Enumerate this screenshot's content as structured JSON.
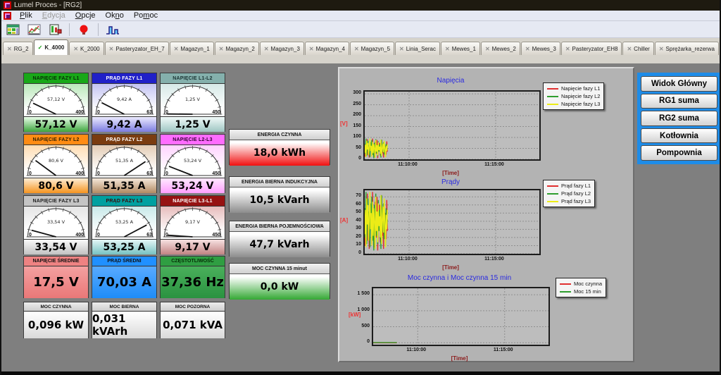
{
  "window": {
    "title": "Lumel Proces - [RG2]"
  },
  "menu": {
    "items": [
      {
        "label": "Plik",
        "accel": "P",
        "disabled": false
      },
      {
        "label": "Edycja",
        "accel": "E",
        "disabled": true
      },
      {
        "label": "Opcje",
        "accel": "O",
        "disabled": false
      },
      {
        "label": "Okno",
        "accel": "n",
        "disabled": false
      },
      {
        "label": "Pomoc",
        "accel": "m",
        "disabled": false
      }
    ]
  },
  "toolbar": {
    "icons": [
      "data-table-icon",
      "trend-chart-icon",
      "report-icon",
      "alarm-lamp-icon",
      "bar-graph-icon"
    ]
  },
  "icons": {
    "tab_close": "✕",
    "tab_active_check": "✓"
  },
  "tabs": [
    {
      "label": "RG_2"
    },
    {
      "label": "K_4000",
      "active": true
    },
    {
      "label": "K_2000"
    },
    {
      "label": "Pasteryzator_EH_7"
    },
    {
      "label": "Magazyn_1"
    },
    {
      "label": "Magazyn_2"
    },
    {
      "label": "Magazyn_3"
    },
    {
      "label": "Magazyn_4"
    },
    {
      "label": "Magazyn_5"
    },
    {
      "label": "Linia_Serac"
    },
    {
      "label": "Mewes_1"
    },
    {
      "label": "Mewes_2"
    },
    {
      "label": "Mewes_3"
    },
    {
      "label": "Pasteryzator_EH8"
    },
    {
      "label": "Chiller"
    },
    {
      "label": "Sprężarka_rezerwa"
    }
  ],
  "gauges": [
    {
      "title": "NAPIĘCIE FAZY L1",
      "display": "57,12 V",
      "value": 57.12,
      "max": 400,
      "min_label": "0",
      "max_label": "400",
      "header_bg": "#18a818",
      "header_fg": "#062d06",
      "tint": "#b9e8b9",
      "bar_top": "#eaffea",
      "bar_bot": "#3da53d"
    },
    {
      "title": "PRĄD FAZY L1",
      "display": "9,42 A",
      "value": 9.42,
      "max": 63,
      "min_label": "0",
      "max_label": "63",
      "header_bg": "#2020c8",
      "header_fg": "#ffffff",
      "tint": "#c3c3f2",
      "bar_top": "#ecebff",
      "bar_bot": "#7b7be0"
    },
    {
      "title": "NAPIĘCIE L1-L2",
      "display": "1,25 V",
      "value": 1.25,
      "max": 450,
      "min_label": "0",
      "max_label": "450",
      "header_bg": "#84b0ac",
      "header_fg": "#1a3333",
      "tint": "#d6e9e7",
      "bar_top": "#f1faf9",
      "bar_bot": "#9fc6c2"
    },
    {
      "title": "NAPIĘCIE FAZY L2",
      "display": "80,6 V",
      "value": 80.6,
      "max": 400,
      "min_label": "0",
      "max_label": "400",
      "header_bg": "#ff8c14",
      "header_fg": "#332200",
      "tint": "#ffddb2",
      "bar_top": "#ffeed6",
      "bar_bot": "#f5941f"
    },
    {
      "title": "PRĄD FAZY L2",
      "display": "51,35 A",
      "value": 51.35,
      "max": 63,
      "min_label": "0",
      "max_label": "63",
      "header_bg": "#7a3c10",
      "header_fg": "#ffffff",
      "tint": "#e3ccb5",
      "bar_top": "#f5e8da",
      "bar_bot": "#b28a62"
    },
    {
      "title": "NAPIĘCIE L2-L3",
      "display": "53,24 V",
      "value": 53.24,
      "max": 450,
      "min_label": "0",
      "max_label": "450",
      "header_bg": "#ff6cff",
      "header_fg": "#330033",
      "tint": "#ffd3ff",
      "bar_top": "#ffeaff",
      "bar_bot": "#ff9eff"
    },
    {
      "title": "NAPIĘCIE FAZY L3",
      "display": "33,54 V",
      "value": 33.54,
      "max": 400,
      "min_label": "0",
      "max_label": "400",
      "header_bg": "#c4c4c4",
      "header_fg": "#1d1d1d",
      "tint": "#e5e5e5",
      "bar_top": "#fbfbfb",
      "bar_bot": "#c2c2c2"
    },
    {
      "title": "PRĄD FAZY L3",
      "display": "53,25 A",
      "value": 53.25,
      "max": 63,
      "min_label": "0",
      "max_label": "63",
      "header_bg": "#00a0a0",
      "header_fg": "#3a0a0a",
      "tint": "#c8e9e9",
      "bar_top": "#e5f7f7",
      "bar_bot": "#77c2c2"
    },
    {
      "title": "NAPIĘCIE L3-L1",
      "display": "9,17 V",
      "value": 9.17,
      "max": 450,
      "min_label": "0",
      "max_label": "450",
      "header_bg": "#961212",
      "header_fg": "#ffffff",
      "tint": "#e7bcbc",
      "bar_top": "#f7e2e2",
      "bar_bot": "#c28383"
    }
  ],
  "meters_row4": [
    {
      "title": "NAPIĘCIE ŚREDNIE",
      "value": "17,5 V",
      "bg_top": "#f4a0a0",
      "bg_bot": "#ea7878",
      "header_bg": "#ee8282",
      "header_fg": "#111111"
    },
    {
      "title": "PRĄD ŚREDNI",
      "value": "70,03 A",
      "bg_top": "#58aaff",
      "bg_bot": "#1e8cf8",
      "header_bg": "#2090ff",
      "header_fg": "#111111"
    },
    {
      "title": "CZĘSTOTLIWOŚĆ",
      "value": "37,36 Hz",
      "bg_top": "#4ab05c",
      "bg_bot": "#2a9240",
      "header_bg": "#2f9e42",
      "header_fg": "#062d06"
    }
  ],
  "meters_row5": [
    {
      "title": "MOC CZYNNA",
      "value": "0,096 kW"
    },
    {
      "title": "MOC BIERNA",
      "value": "0,031 kVArh"
    },
    {
      "title": "MOC POZORNA",
      "value": "0,071 kVA"
    }
  ],
  "energy_panels": [
    {
      "title": "ENERGIA CZYNNA",
      "value": "18,0 kWh",
      "grad_top": "#ffffff",
      "grad_bot": "#f01010"
    },
    {
      "title": "ENERGIA BIERNA INDUKCYJNA",
      "value": "10,5 kVarh",
      "grad_top": "#ffffff",
      "grad_bot": "#8c8c8c"
    },
    {
      "title": "ENERGIA BIERNA POJEMNOŚCIOWA",
      "value": "47,7 kVarh",
      "grad_top": "#ffffff",
      "grad_bot": "#8c8c8c"
    },
    {
      "title": "MOC CZYNNA 15 minut",
      "value": "0,0 kW",
      "grad_top": "#ffffff",
      "grad_bot": "#34a834"
    }
  ],
  "nav": {
    "border_color": "#1e8ce8",
    "buttons": [
      "Widok Główny",
      "RG1 suma",
      "RG2 suma",
      "Kotłownia",
      "Pompownia"
    ]
  },
  "chart_data": [
    {
      "type": "line",
      "title": "Napięcia",
      "ylabel": "[V]",
      "xlabel": "[Time]",
      "ylim": [
        0,
        310
      ],
      "yticks": [
        0,
        50,
        100,
        150,
        200,
        250,
        300
      ],
      "ytick_labels": [
        "0",
        "50",
        "100",
        "150",
        "200",
        "250",
        "300"
      ],
      "x_ticks": [
        {
          "label": "11:10:00",
          "frac": 0.254
        },
        {
          "label": "11:15:00",
          "frac": 0.75
        }
      ],
      "data_end_frac": 0.13,
      "grid": "dashed",
      "legend_position": "right",
      "series": [
        {
          "name": "Napięcie fazy L1",
          "color": "#e03030",
          "values": [
            45,
            12,
            78,
            30,
            92,
            20,
            60,
            8,
            85,
            40,
            70,
            15,
            95,
            35,
            55,
            10,
            80,
            48,
            25,
            88,
            5,
            65,
            38,
            75,
            18,
            58,
            90,
            28,
            50,
            8,
            72,
            42,
            62,
            22,
            82,
            35
          ]
        },
        {
          "name": "Napięcie fazy L2",
          "color": "#2f9e2f",
          "values": [
            70,
            25,
            95,
            15,
            50,
            85,
            30,
            65,
            10,
            78,
            45,
            88,
            20,
            60,
            5,
            75,
            40,
            92,
            28,
            55,
            15,
            82,
            35,
            68,
            48,
            8,
            90,
            32,
            58,
            78,
            22,
            62,
            12,
            70,
            42,
            52
          ]
        },
        {
          "name": "Napięcie fazy L3",
          "color": "#ecec17",
          "values": [
            30,
            68,
            10,
            85,
            45,
            75,
            20,
            55,
            95,
            38,
            62,
            12,
            80,
            28,
            70,
            50,
            8,
            88,
            35,
            65,
            18,
            78,
            42,
            58,
            25,
            90,
            15,
            52,
            72,
            32,
            85,
            48,
            10,
            60,
            38,
            68
          ]
        }
      ]
    },
    {
      "type": "line",
      "title": "Prądy",
      "ylabel": "[A]",
      "xlabel": "[Time]",
      "ylim": [
        0,
        78
      ],
      "yticks": [
        0,
        10,
        20,
        30,
        40,
        50,
        60,
        70
      ],
      "ytick_labels": [
        "0",
        "10",
        "20",
        "30",
        "40",
        "50",
        "60",
        "70"
      ],
      "x_ticks": [
        {
          "label": "11:10:00",
          "frac": 0.254
        },
        {
          "label": "11:15:00",
          "frac": 0.75
        }
      ],
      "data_end_frac": 0.13,
      "grid": "dashed",
      "legend_position": "right",
      "series": [
        {
          "name": "Prąd fazy L1",
          "color": "#e03030",
          "values": [
            36,
            10,
            62,
            24,
            74,
            16,
            48,
            6,
            68,
            32,
            56,
            12,
            76,
            28,
            44,
            8,
            64,
            38,
            20,
            70,
            4,
            52,
            30,
            60,
            14,
            46,
            72,
            22,
            40,
            6,
            58,
            34,
            50,
            18,
            66,
            28
          ]
        },
        {
          "name": "Prąd fazy L2",
          "color": "#2f9e2f",
          "values": [
            56,
            20,
            76,
            12,
            40,
            68,
            24,
            52,
            8,
            62,
            36,
            70,
            16,
            48,
            4,
            60,
            32,
            74,
            22,
            44,
            12,
            66,
            28,
            54,
            38,
            6,
            72,
            26,
            46,
            62,
            18,
            50,
            10,
            56,
            34,
            42
          ]
        },
        {
          "name": "Prąd fazy L3",
          "color": "#ecec17",
          "values": [
            24,
            54,
            8,
            68,
            36,
            60,
            16,
            44,
            76,
            30,
            50,
            10,
            64,
            22,
            56,
            40,
            6,
            70,
            28,
            52,
            14,
            62,
            34,
            46,
            20,
            72,
            12,
            42,
            58,
            26,
            68,
            38,
            8,
            48,
            30,
            54
          ]
        }
      ]
    },
    {
      "type": "line",
      "title": "Moc czynna i Moc czynna 15 min",
      "ylabel": "[kW]",
      "xlabel": "[Time]",
      "ylim": [
        -60,
        1700
      ],
      "yticks": [
        0,
        500,
        1000,
        1500
      ],
      "ytick_labels": [
        "0",
        "500",
        "1 000",
        "1 500"
      ],
      "x_ticks": [
        {
          "label": "11:10:00",
          "frac": 0.254
        },
        {
          "label": "11:15:00",
          "frac": 0.75
        }
      ],
      "data_end_frac": 0.135,
      "grid": "dashed",
      "legend_position": "right",
      "series": [
        {
          "name": "Moc czynna",
          "color": "#e03030",
          "values": [
            0,
            0,
            0,
            0,
            0,
            0,
            0,
            0,
            0,
            0,
            0,
            0
          ]
        },
        {
          "name": "Moc 15 min",
          "color": "#2f9e2f",
          "values": [
            8,
            8,
            8,
            8,
            8,
            8,
            8,
            8,
            8,
            8,
            8,
            8
          ]
        }
      ]
    }
  ]
}
